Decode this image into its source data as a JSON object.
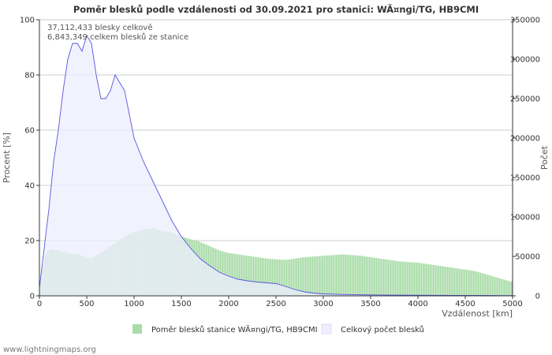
{
  "chart_data": {
    "type": "area",
    "title": "Poměr blesků podle vzdálenosti od 30.09.2021 pro stanici: WÃ¤ngi/TG, HB9CMI",
    "annotations": [
      "37,112,433 blesky celkově",
      "6,843,349 celkem blesků ze stanice"
    ],
    "xlabel": "Vzdálenost   [km]",
    "ylabel_left": "Procent   [%]",
    "ylabel_right": "Počet",
    "xlim": [
      0,
      5000
    ],
    "ylim_left": [
      0,
      100
    ],
    "ylim_right": [
      0,
      350000
    ],
    "x_ticks": [
      "0",
      "500",
      "1000",
      "1500",
      "2000",
      "2500",
      "3000",
      "3500",
      "4000",
      "4500",
      "5000"
    ],
    "y_left_ticks": [
      "0",
      "20",
      "40",
      "60",
      "80",
      "100"
    ],
    "y_right_ticks": [
      "0",
      "50000",
      "100000",
      "150000",
      "200000",
      "250000",
      "300000",
      "350000"
    ],
    "grid": true,
    "legend_position": "bottom",
    "series": [
      {
        "name": "Poměr blesků stanice WÃ¤ngi/TG, HB9CMI",
        "axis": "left",
        "color": "#a8dca8",
        "x": [
          0,
          50,
          100,
          200,
          300,
          400,
          500,
          550,
          600,
          700,
          800,
          900,
          1000,
          1100,
          1200,
          1300,
          1400,
          1500,
          1600,
          1700,
          1800,
          1900,
          2000,
          2200,
          2400,
          2600,
          2800,
          3000,
          3200,
          3400,
          3600,
          3800,
          4000,
          4200,
          4400,
          4600,
          4800,
          5000
        ],
        "values": [
          2,
          14,
          17,
          16.5,
          15.5,
          15,
          14,
          13.5,
          14.5,
          17,
          19,
          21.5,
          23,
          24,
          24.5,
          23.5,
          23,
          21.5,
          20.5,
          19.5,
          18,
          16.5,
          15.5,
          14.5,
          13.5,
          13,
          14,
          14.5,
          15,
          14.5,
          13.5,
          12.5,
          12,
          11,
          10,
          9,
          7,
          5
        ]
      },
      {
        "name": "Celkový počet blesků",
        "axis": "right",
        "color": "#eeeeff",
        "line_color": "#5555dd",
        "x": [
          0,
          50,
          100,
          150,
          200,
          250,
          300,
          350,
          400,
          450,
          500,
          550,
          600,
          650,
          700,
          750,
          800,
          850,
          900,
          950,
          1000,
          1050,
          1100,
          1200,
          1300,
          1400,
          1500,
          1600,
          1700,
          1800,
          1900,
          2000,
          2100,
          2200,
          2300,
          2400,
          2500,
          2600,
          2700,
          2800,
          2900,
          3000,
          3200,
          3400,
          3600,
          3800,
          4000,
          4200,
          4400,
          4600,
          4800,
          5000
        ],
        "values": [
          10000,
          60000,
          110000,
          170000,
          210000,
          260000,
          300000,
          320000,
          320000,
          310000,
          330000,
          320000,
          280000,
          250000,
          250000,
          260000,
          280000,
          270000,
          260000,
          230000,
          200000,
          185000,
          170000,
          145000,
          120000,
          95000,
          75000,
          60000,
          47000,
          38000,
          30000,
          25000,
          21000,
          19000,
          17500,
          16500,
          15500,
          12000,
          8000,
          5000,
          3500,
          2500,
          1800,
          1300,
          1100,
          900,
          800,
          700,
          600,
          500,
          400,
          300
        ]
      }
    ]
  },
  "credit": "www.lightningmaps.org"
}
